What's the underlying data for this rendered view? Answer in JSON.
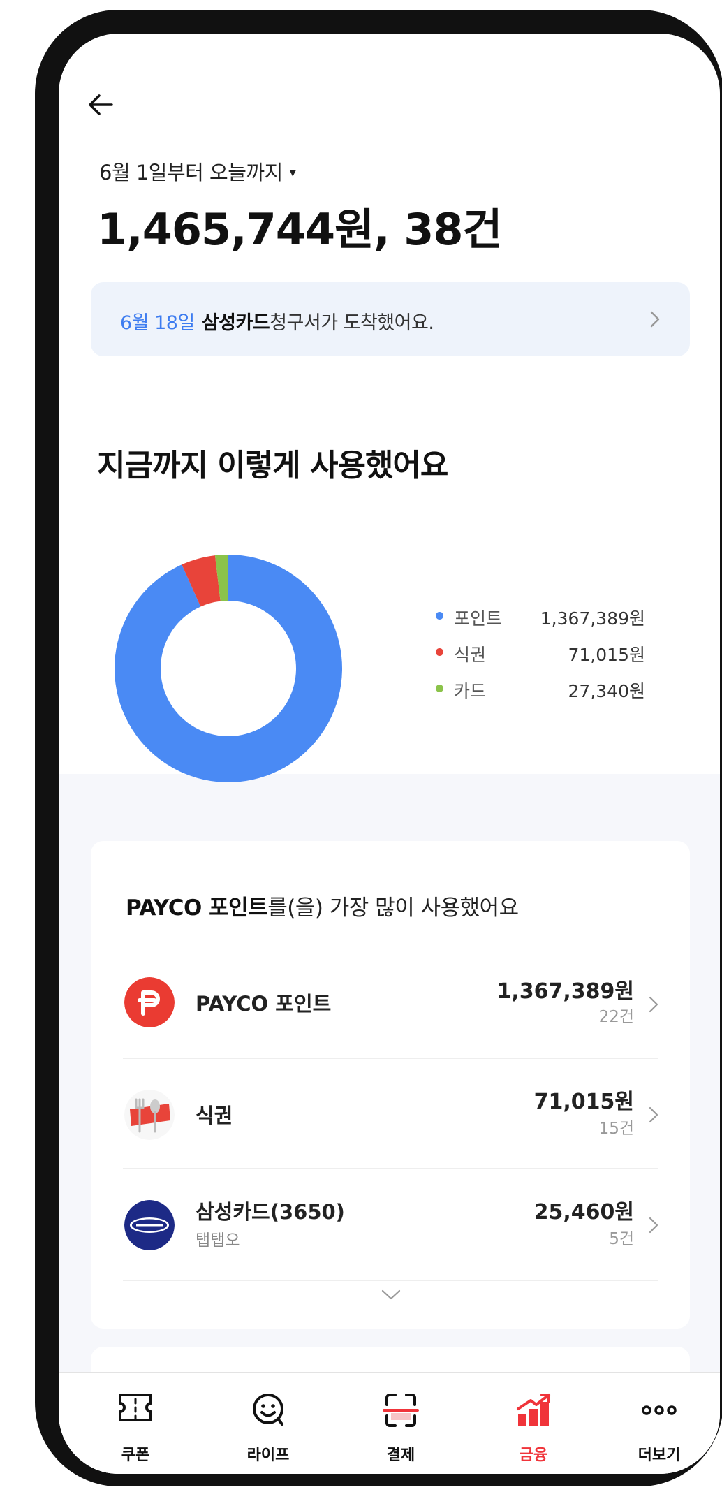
{
  "header": {
    "range_label": "6월 1일부터 오늘까지",
    "caret": "▾",
    "total": "1,465,744원, 38건"
  },
  "notice": {
    "date": "6월 18일",
    "card_name": "삼성카드",
    "message": "청구서가 도착했어요."
  },
  "usage": {
    "title": "지금까지 이렇게 사용했어요"
  },
  "chart_data": {
    "type": "pie",
    "categories": [
      "포인트",
      "식권",
      "카드"
    ],
    "values": [
      1367389,
      71015,
      27340
    ],
    "value_labels": [
      "1,367,389원",
      "71,015원",
      "27,340원"
    ],
    "colors": [
      "#4a8af4",
      "#e8443a",
      "#8bc34a"
    ],
    "legend": "right"
  },
  "top_card": {
    "title_bold": "PAYCO 포인트",
    "title_rest": "를(을) 가장 많이 사용했어요",
    "items": [
      {
        "name": "PAYCO 포인트",
        "sub": "",
        "amount": "1,367,389원",
        "count": "22건",
        "icon": "payco-point-icon"
      },
      {
        "name": "식권",
        "sub": "",
        "amount": "71,015원",
        "count": "15건",
        "icon": "meal-ticket-icon"
      },
      {
        "name": "삼성카드(3650)",
        "sub": "탭탭오",
        "amount": "25,460원",
        "count": "5건",
        "icon": "samsung-card-icon"
      }
    ]
  },
  "tabbar": {
    "tabs": [
      {
        "label": "쿠폰",
        "icon": "coupon-icon",
        "active": false
      },
      {
        "label": "라이프",
        "icon": "life-icon",
        "active": false
      },
      {
        "label": "결제",
        "icon": "payment-scan-icon",
        "active": false
      },
      {
        "label": "금융",
        "icon": "finance-chart-icon",
        "active": true
      },
      {
        "label": "더보기",
        "icon": "more-icon",
        "active": false
      }
    ]
  },
  "colors": {
    "accent_red": "#f0343a",
    "link_blue": "#3d7cf0",
    "notice_bg": "#eef3fb"
  }
}
